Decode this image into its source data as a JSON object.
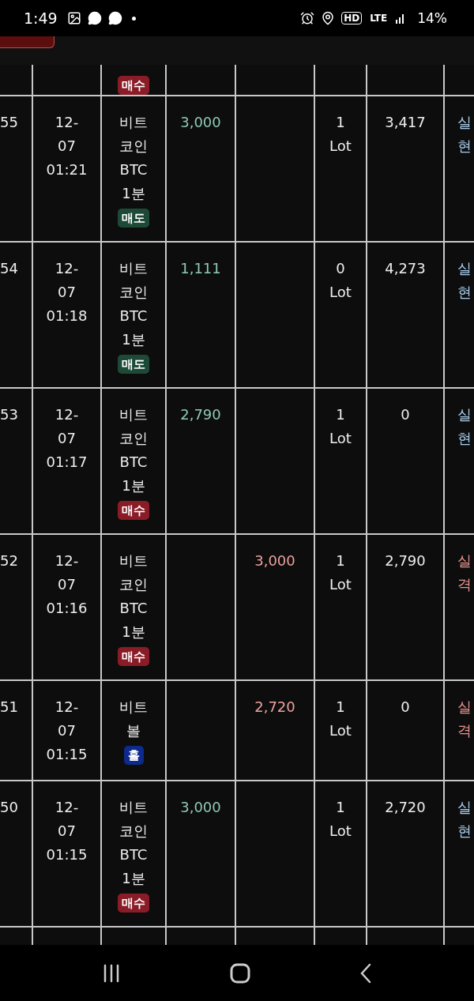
{
  "status_bar": {
    "time": "1:49",
    "network_labels": [
      "HD",
      "LTE"
    ],
    "battery": "14%"
  },
  "table": {
    "partial_top_row": {
      "side": {
        "label": "매수",
        "kind": "buy"
      }
    },
    "rows": [
      {
        "no": "55",
        "date": "12-07",
        "time": "01:21",
        "product": "비트코인 BTC 1분",
        "side": {
          "label": "매도",
          "kind": "sell"
        },
        "buy_amount": "3,000",
        "sell_amount": "",
        "quantity": "1 Lot",
        "balance": "3,417",
        "result": {
          "label": "실현",
          "kind": "realized"
        }
      },
      {
        "no": "54",
        "date": "12-07",
        "time": "01:18",
        "product": "비트코인 BTC 1분",
        "side": {
          "label": "매도",
          "kind": "sell"
        },
        "buy_amount": "1,111",
        "sell_amount": "",
        "quantity": "0 Lot",
        "balance": "4,273",
        "result": {
          "label": "실현",
          "kind": "realized"
        }
      },
      {
        "no": "53",
        "date": "12-07",
        "time": "01:17",
        "product": "비트코인 BTC 1분",
        "side": {
          "label": "매수",
          "kind": "buy"
        },
        "buy_amount": "2,790",
        "sell_amount": "",
        "quantity": "1 Lot",
        "balance": "0",
        "result": {
          "label": "실현",
          "kind": "realized"
        }
      },
      {
        "no": "52",
        "date": "12-07",
        "time": "01:16",
        "product": "비트코인 BTC 1분",
        "side": {
          "label": "매수",
          "kind": "buy"
        },
        "buy_amount": "",
        "sell_amount": "3,000",
        "quantity": "1 Lot",
        "balance": "2,790",
        "result": {
          "label": "실격",
          "kind": "failed"
        }
      },
      {
        "no": "51",
        "date": "12-07",
        "time": "01:15",
        "product": "비트볼",
        "side": {
          "label": "홀",
          "kind": "hold"
        },
        "buy_amount": "",
        "sell_amount": "2,720",
        "quantity": "1 Lot",
        "balance": "0",
        "result": {
          "label": "실격",
          "kind": "failed"
        }
      },
      {
        "no": "50",
        "date": "12-07",
        "time": "01:15",
        "product": "비트코인 BTC 1분",
        "side": {
          "label": "매수",
          "kind": "buy"
        },
        "buy_amount": "3,000",
        "sell_amount": "",
        "quantity": "1 Lot",
        "balance": "2,720",
        "result": {
          "label": "실현",
          "kind": "realized"
        }
      }
    ]
  }
}
